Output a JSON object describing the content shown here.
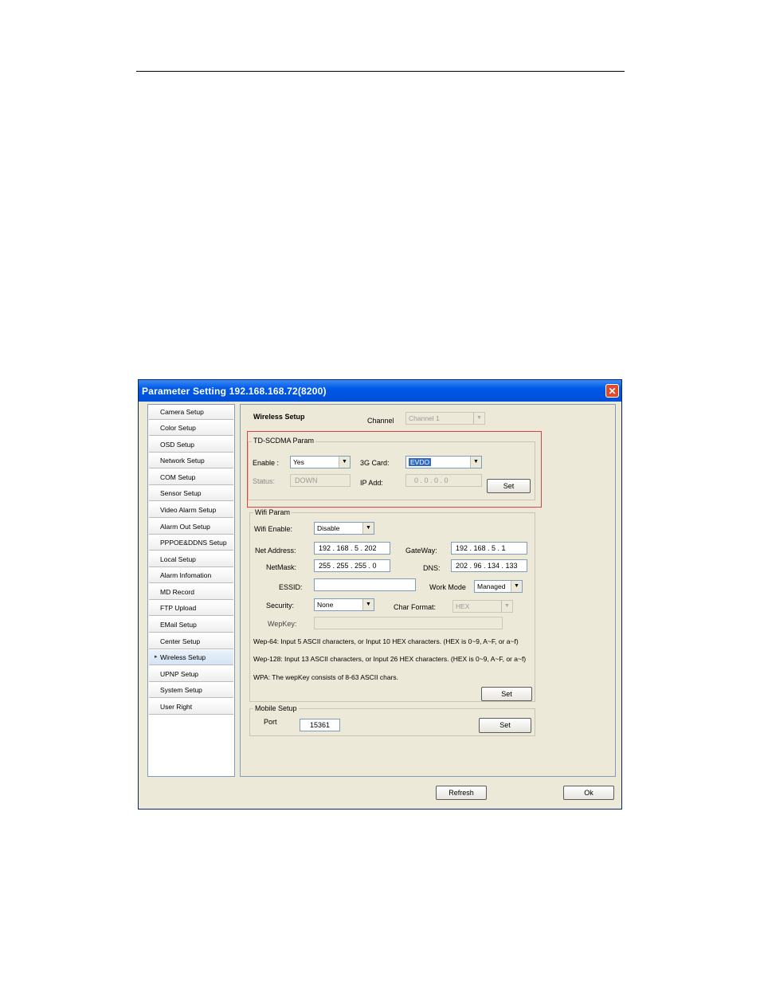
{
  "window": {
    "title": "Parameter Setting 192.168.168.72(8200)",
    "close_glyph": "✕"
  },
  "nav": [
    {
      "label": "Camera Setup"
    },
    {
      "label": "Color Setup"
    },
    {
      "label": "OSD Setup"
    },
    {
      "label": "Network Setup"
    },
    {
      "label": "COM Setup"
    },
    {
      "label": "Sensor Setup"
    },
    {
      "label": "Video Alarm Setup"
    },
    {
      "label": "Alarm Out Setup"
    },
    {
      "label": "PPPOE&DDNS Setup"
    },
    {
      "label": "Local Setup"
    },
    {
      "label": "Alarm Infomation"
    },
    {
      "label": "MD Record"
    },
    {
      "label": "FTP Upload"
    },
    {
      "label": "EMail Setup"
    },
    {
      "label": "Center Setup"
    },
    {
      "label": "Wireless Setup"
    },
    {
      "label": "UPNP Setup"
    },
    {
      "label": "System Setup"
    },
    {
      "label": "User Right"
    }
  ],
  "selected_arrow": "▸",
  "header": {
    "title": "Wireless Setup",
    "channel_label": "Channel",
    "channel_value": "Channel 1"
  },
  "td": {
    "legend": "TD-SCDMA Param",
    "enable_label": "Enable :",
    "enable_value": "Yes",
    "card_label": "3G Card:",
    "card_value": "EVDO",
    "status_label": "Status:",
    "status_value": "DOWN",
    "ip_label": "IP Add:",
    "ip_value": "0  .  0  .  0  .  0",
    "set": "Set"
  },
  "wifi": {
    "legend": "Wifi Param",
    "enable_label": "Wifi Enable:",
    "enable_value": "Disable",
    "net_label": "Net Address:",
    "net_value": "192 . 168 .  5  . 202",
    "gw_label": "GateWay:",
    "gw_value": "192 . 168 .  5  .  1",
    "mask_label": "NetMask:",
    "mask_value": "255 . 255 . 255 .  0",
    "dns_label": "DNS:",
    "dns_value": "202 . 96 . 134 . 133",
    "essid_label": "ESSID:",
    "essid_value": "",
    "mode_label": "Work Mode",
    "mode_value": "Managed",
    "security_label": "Security:",
    "security_value": "None",
    "charfmt_label": "Char Format:",
    "charfmt_value": "HEX",
    "wepkey_label": "WepKey:",
    "wepkey_value": "",
    "note1": "Wep-64: Input 5 ASCII characters, or Input 10 HEX characters. (HEX is 0~9, A~F, or a~f)",
    "note2": "Wep-128: Input 13 ASCII characters, or Input 26 HEX characters. (HEX is 0~9, A~F, or a~f)",
    "note3": "WPA: The wepKey consists of 8-63 ASCII chars.",
    "set": "Set"
  },
  "mobile": {
    "legend": "Mobile Setup",
    "port_label": "Port",
    "port_value": "15361",
    "set": "Set"
  },
  "footer": {
    "refresh": "Refresh",
    "ok": "Ok"
  },
  "dropdown_glyph": "▼"
}
